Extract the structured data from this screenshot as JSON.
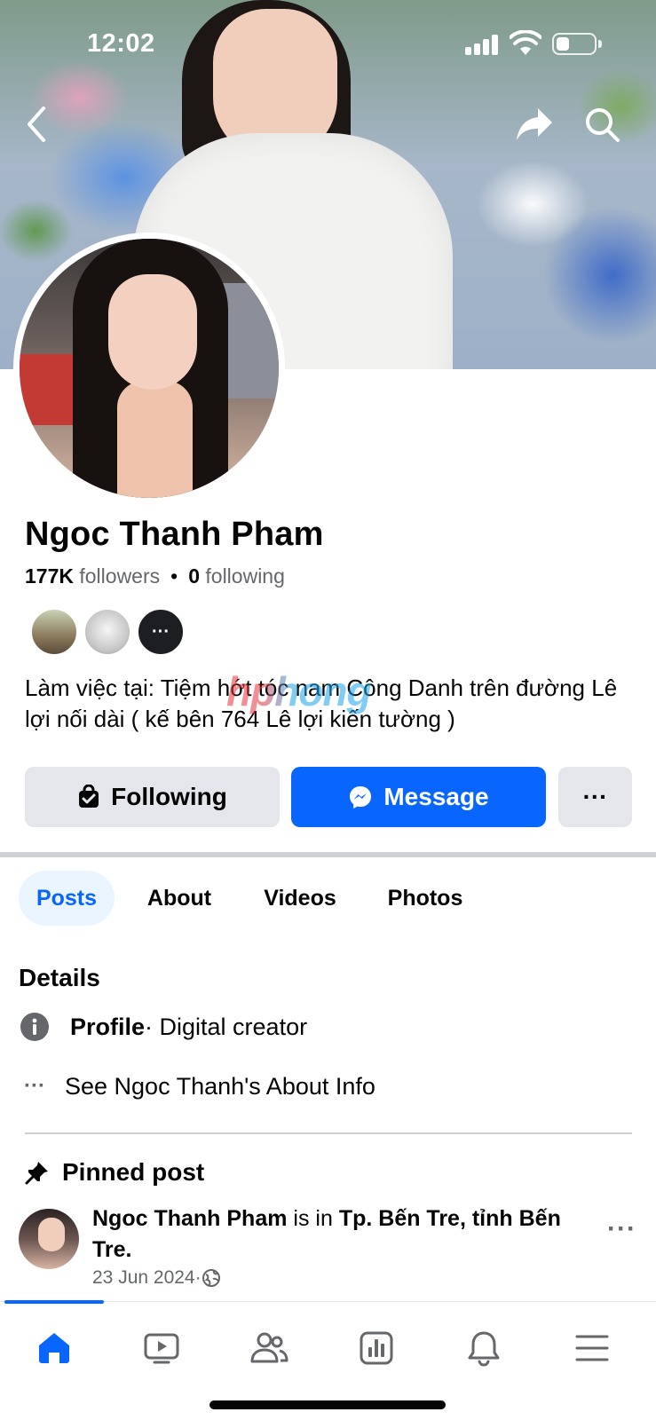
{
  "status_bar": {
    "time": "12:02",
    "battery_level": 0.35
  },
  "header": {
    "back_icon": "chevron-left-icon",
    "share_icon": "share-icon",
    "search_icon": "search-icon"
  },
  "profile": {
    "name": "Ngoc Thanh Pham",
    "followers_count": "177K",
    "followers_label": "followers",
    "separator": "•",
    "following_count": "0",
    "following_label": "following",
    "mutual_more": "···",
    "bio": "Làm việc tại: Tiệm hớt tóc nam Công Danh trên đường Lê lợi nối dài ( kế bên 764 Lê lợi kiến tường )",
    "watermark": "hphong"
  },
  "actions": {
    "following_label": "Following",
    "message_label": "Message",
    "more_label": "···",
    "colors": {
      "primary": "#0866ff",
      "secondary": "#e4e6eb"
    }
  },
  "tabs": [
    {
      "label": "Posts",
      "active": true
    },
    {
      "label": "About",
      "active": false
    },
    {
      "label": "Videos",
      "active": false
    },
    {
      "label": "Photos",
      "active": false
    }
  ],
  "details": {
    "title": "Details",
    "profile_label": "Profile",
    "profile_value": " · Digital creator",
    "about_more_icon": "···",
    "about_link": "See Ngoc Thanh's About Info"
  },
  "pinned": {
    "title": "Pinned post",
    "author": "Ngoc Thanh Pham",
    "is_in": " is in ",
    "location": "Tp. Bến Tre, tỉnh Bến Tre.",
    "date": "23 Jun 2024",
    "meta_sep": " · ",
    "more": "···"
  },
  "bottom_nav": [
    {
      "icon": "home-icon",
      "active": true
    },
    {
      "icon": "video-icon",
      "active": false
    },
    {
      "icon": "friends-icon",
      "active": false
    },
    {
      "icon": "dashboard-icon",
      "active": false
    },
    {
      "icon": "bell-icon",
      "active": false
    },
    {
      "icon": "menu-icon",
      "active": false
    }
  ]
}
